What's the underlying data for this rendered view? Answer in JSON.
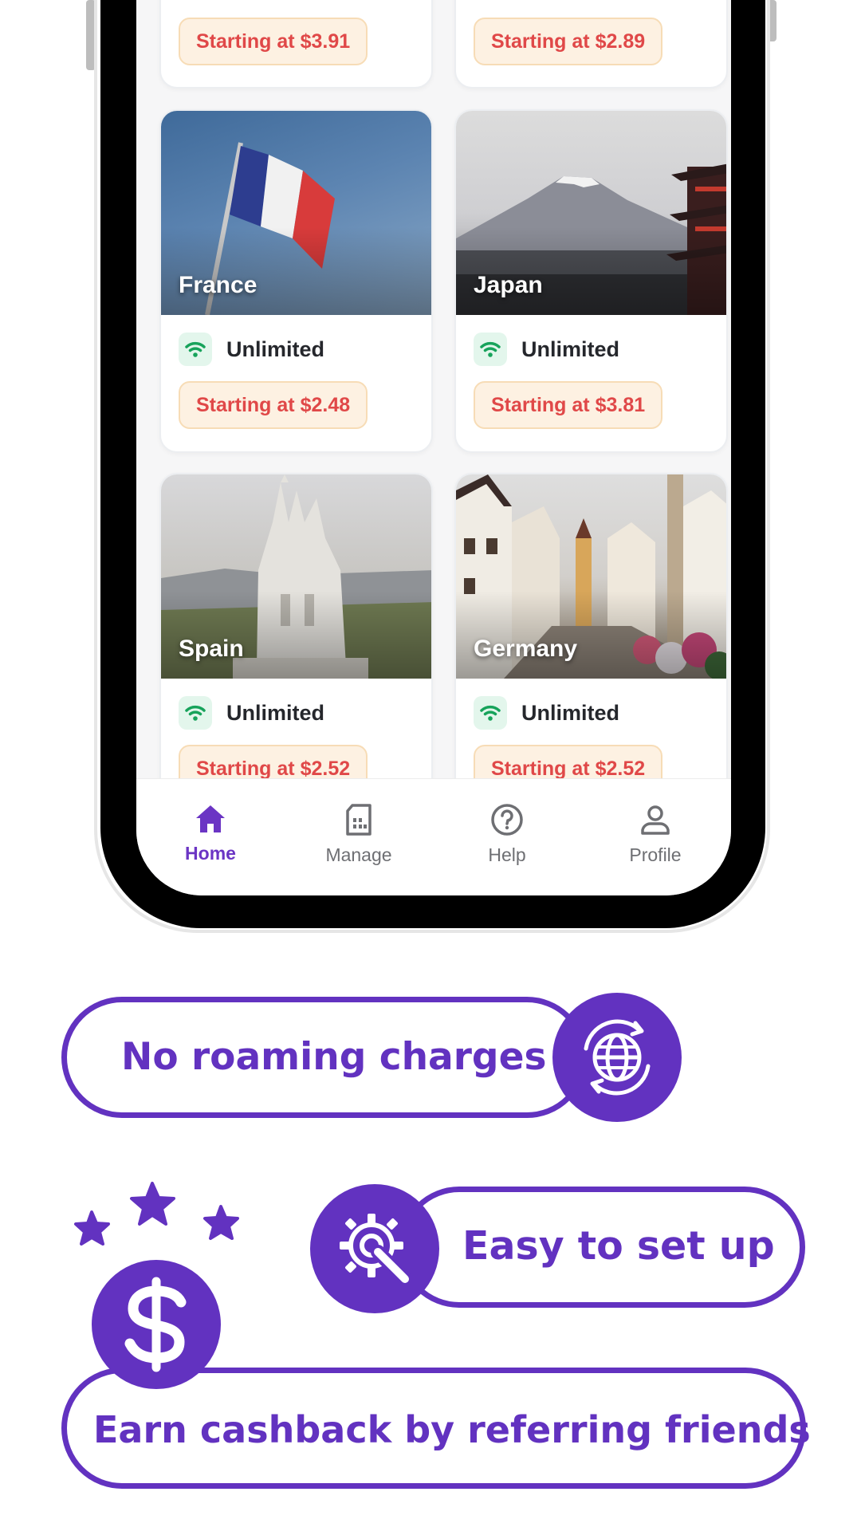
{
  "colors": {
    "brand_purple": "#6232c0",
    "price_red": "#e04848",
    "price_bg": "#fdf1e2",
    "wifi_green": "#17a35b"
  },
  "cards_top": [
    {
      "price": "Starting at $3.91"
    },
    {
      "price": "Starting at $2.89"
    }
  ],
  "cards": [
    {
      "country": "France",
      "data": "Unlimited",
      "price": "Starting at $2.48",
      "icon": "wifi-icon"
    },
    {
      "country": "Japan",
      "data": "Unlimited",
      "price": "Starting at $3.81",
      "icon": "wifi-icon"
    },
    {
      "country": "Spain",
      "data": "Unlimited",
      "price": "Starting at $2.52",
      "icon": "wifi-icon"
    },
    {
      "country": "Germany",
      "data": "Unlimited",
      "price": "Starting at $2.52",
      "icon": "wifi-icon"
    }
  ],
  "nav": [
    {
      "label": "Home",
      "icon": "home-icon",
      "active": true
    },
    {
      "label": "Manage",
      "icon": "sim-card-icon",
      "active": false
    },
    {
      "label": "Help",
      "icon": "help-circle-icon",
      "active": false
    },
    {
      "label": "Profile",
      "icon": "person-icon",
      "active": false
    }
  ],
  "features": {
    "roaming": {
      "label": "No roaming charges",
      "icon": "globe-refresh-icon"
    },
    "setup": {
      "label": "Easy to set up",
      "icon": "gear-wrench-icon"
    },
    "cashback": {
      "label": "Earn cashback by referring friends",
      "icon": "dollar-icon",
      "decor": "stars-icon"
    }
  }
}
